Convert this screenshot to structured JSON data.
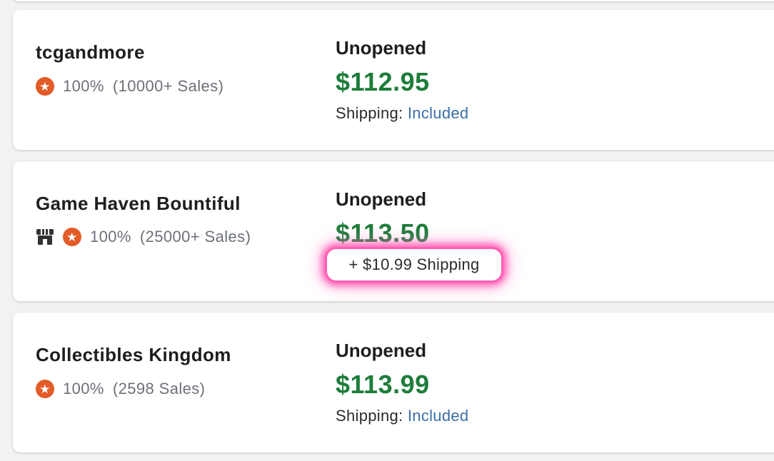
{
  "listings": [
    {
      "seller": "tcgandmore",
      "rating": "100%",
      "sales": "(10000+ Sales)",
      "condition": "Unopened",
      "price": "$112.95",
      "shipping_label": "Shipping:",
      "shipping_value": "Included"
    },
    {
      "seller": "Game Haven Bountiful",
      "rating": "100%",
      "sales": "(25000+ Sales)",
      "condition": "Unopened",
      "price": "$113.50",
      "shipping_pill": "+ $10.99 Shipping",
      "store_icon": "storefront-icon"
    },
    {
      "seller": "Collectibles Kingdom",
      "rating": "100%",
      "sales": "(2598 Sales)",
      "condition": "Unopened",
      "price": "$113.99",
      "shipping_label": "Shipping:",
      "shipping_value": "Included"
    }
  ],
  "icons": {
    "seller_badge": "star-badge-icon",
    "store": "storefront-icon"
  },
  "colors": {
    "price_green": "#1d7d3a",
    "badge_orange": "#e35b27",
    "link_blue": "#3a6ea5",
    "highlight_pink": "#ff5fb4"
  }
}
